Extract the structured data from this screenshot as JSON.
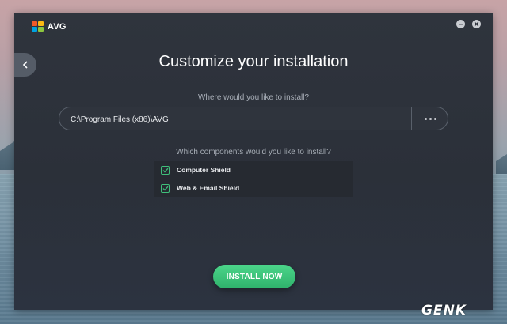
{
  "app": {
    "name": "AVG"
  },
  "window_controls": {
    "minimize_icon": "minimize-icon",
    "close_icon": "close-icon"
  },
  "back": {
    "icon": "chevron-left-icon"
  },
  "page": {
    "title": "Customize your installation"
  },
  "install_location": {
    "question": "Where would you like to install?",
    "path": "C:\\Program Files (x86)\\AVG",
    "browse_icon": "more-dots-icon"
  },
  "components": {
    "question": "Which components would you like to install?",
    "items": [
      {
        "label": "Computer Shield",
        "checked": true
      },
      {
        "label": "Web & Email Shield",
        "checked": true
      }
    ]
  },
  "actions": {
    "install_label": "INSTALL NOW"
  },
  "colors": {
    "accent": "#3fbf7a",
    "window_bg": "#2f343d"
  },
  "watermark": {
    "text": "GENK"
  }
}
